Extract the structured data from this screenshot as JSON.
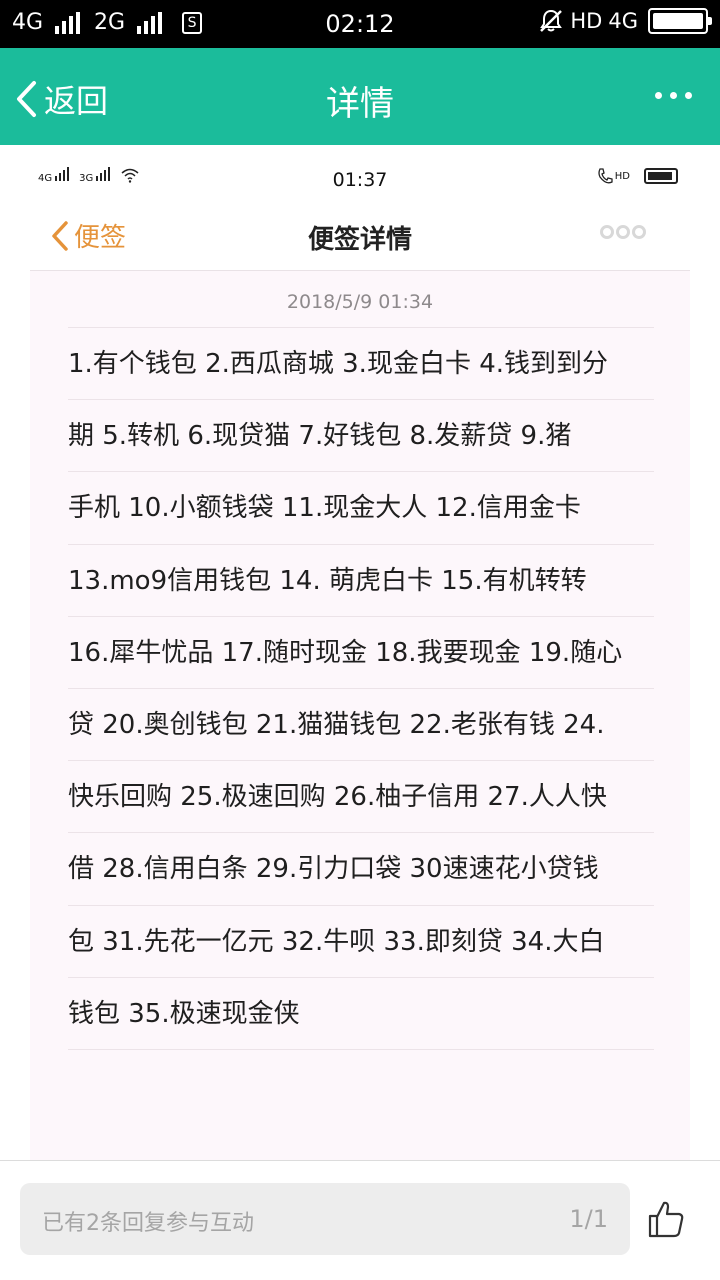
{
  "status_bar": {
    "net1": "4G",
    "net2": "2G",
    "sim_label": "S",
    "time": "02:12",
    "hd": "HD",
    "net3": "4G"
  },
  "app_bar": {
    "back_label": "返回",
    "title": "详情",
    "accent_color": "#1bbc9b"
  },
  "screenshot": {
    "status": {
      "net1": "4G",
      "net2": "3G",
      "time": "01:37",
      "hd": "HD"
    },
    "nav": {
      "back_label": "便签",
      "title": "便签详情"
    },
    "note": {
      "date": "2018/5/9 01:34",
      "lines": [
        "1.有个钱包  2.西瓜商城  3.现金白卡  4.钱到到分",
        "期  5.转机  6.现贷猫  7.好钱包  8.发薪贷  9.猪",
        "手机  10.小额钱袋  11.现金大人  12.信用金卡",
        "13.mo9信用钱包  14. 萌虎白卡 15.有机转转",
        "16.犀牛忧品  17.随时现金  18.我要现金  19.随心",
        "贷  20.奥创钱包  21.猫猫钱包  22.老张有钱  24.",
        "快乐回购  25.极速回购 26.柚子信用  27.人人快",
        "借  28.信用白条  29.引力口袋  30速速花小贷钱",
        "包  31.先花一亿元  32.牛呗  33.即刻贷  34.大白",
        "钱包  35.极速现金侠"
      ]
    }
  },
  "bottom_bar": {
    "reply_placeholder": "已有2条回复参与互动",
    "page_indicator": "1/1"
  }
}
